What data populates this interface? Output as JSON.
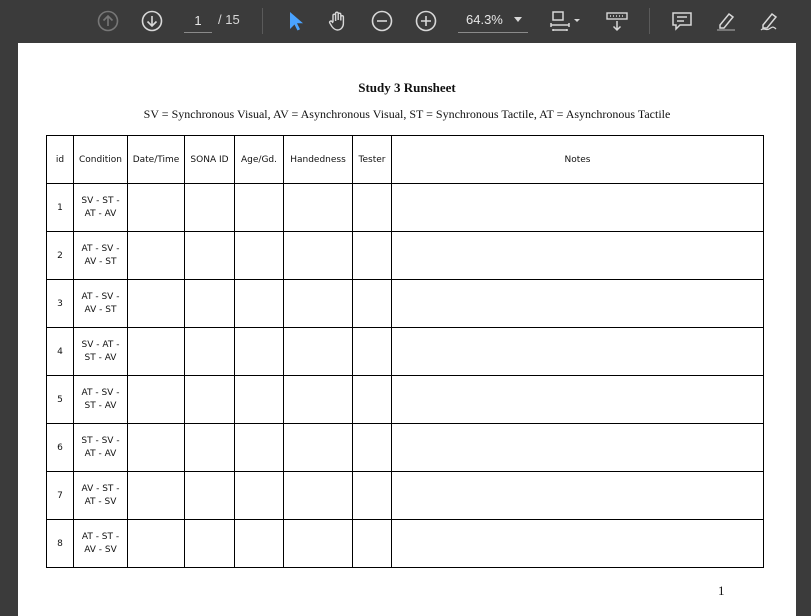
{
  "toolbar": {
    "current_page": "1",
    "page_total": "/ 15",
    "zoom": "64.3%",
    "accent_color": "#4aa3ff"
  },
  "document": {
    "title": "Study 3 Runsheet",
    "subtitle": "SV = Synchronous Visual, AV = Asynchronous Visual, ST = Synchronous Tactile, AT = Asynchronous Tactile",
    "page_number": "1",
    "table": {
      "headers": [
        "id",
        "Condition",
        "Date/Time",
        "SONA ID",
        "Age/Gd.",
        "Handedness",
        "Tester",
        "Notes"
      ],
      "rows": [
        {
          "id": "1",
          "cond1": "SV - ST -",
          "cond2": "AT - AV"
        },
        {
          "id": "2",
          "cond1": "AT - SV -",
          "cond2": "AV - ST"
        },
        {
          "id": "3",
          "cond1": "AT - SV -",
          "cond2": "AV - ST"
        },
        {
          "id": "4",
          "cond1": "SV - AT -",
          "cond2": "ST - AV"
        },
        {
          "id": "5",
          "cond1": "AT - SV -",
          "cond2": "ST - AV"
        },
        {
          "id": "6",
          "cond1": "ST - SV -",
          "cond2": "AT - AV"
        },
        {
          "id": "7",
          "cond1": "AV - ST -",
          "cond2": "AT - SV"
        },
        {
          "id": "8",
          "cond1": "AT - ST -",
          "cond2": "AV - SV"
        }
      ]
    }
  }
}
